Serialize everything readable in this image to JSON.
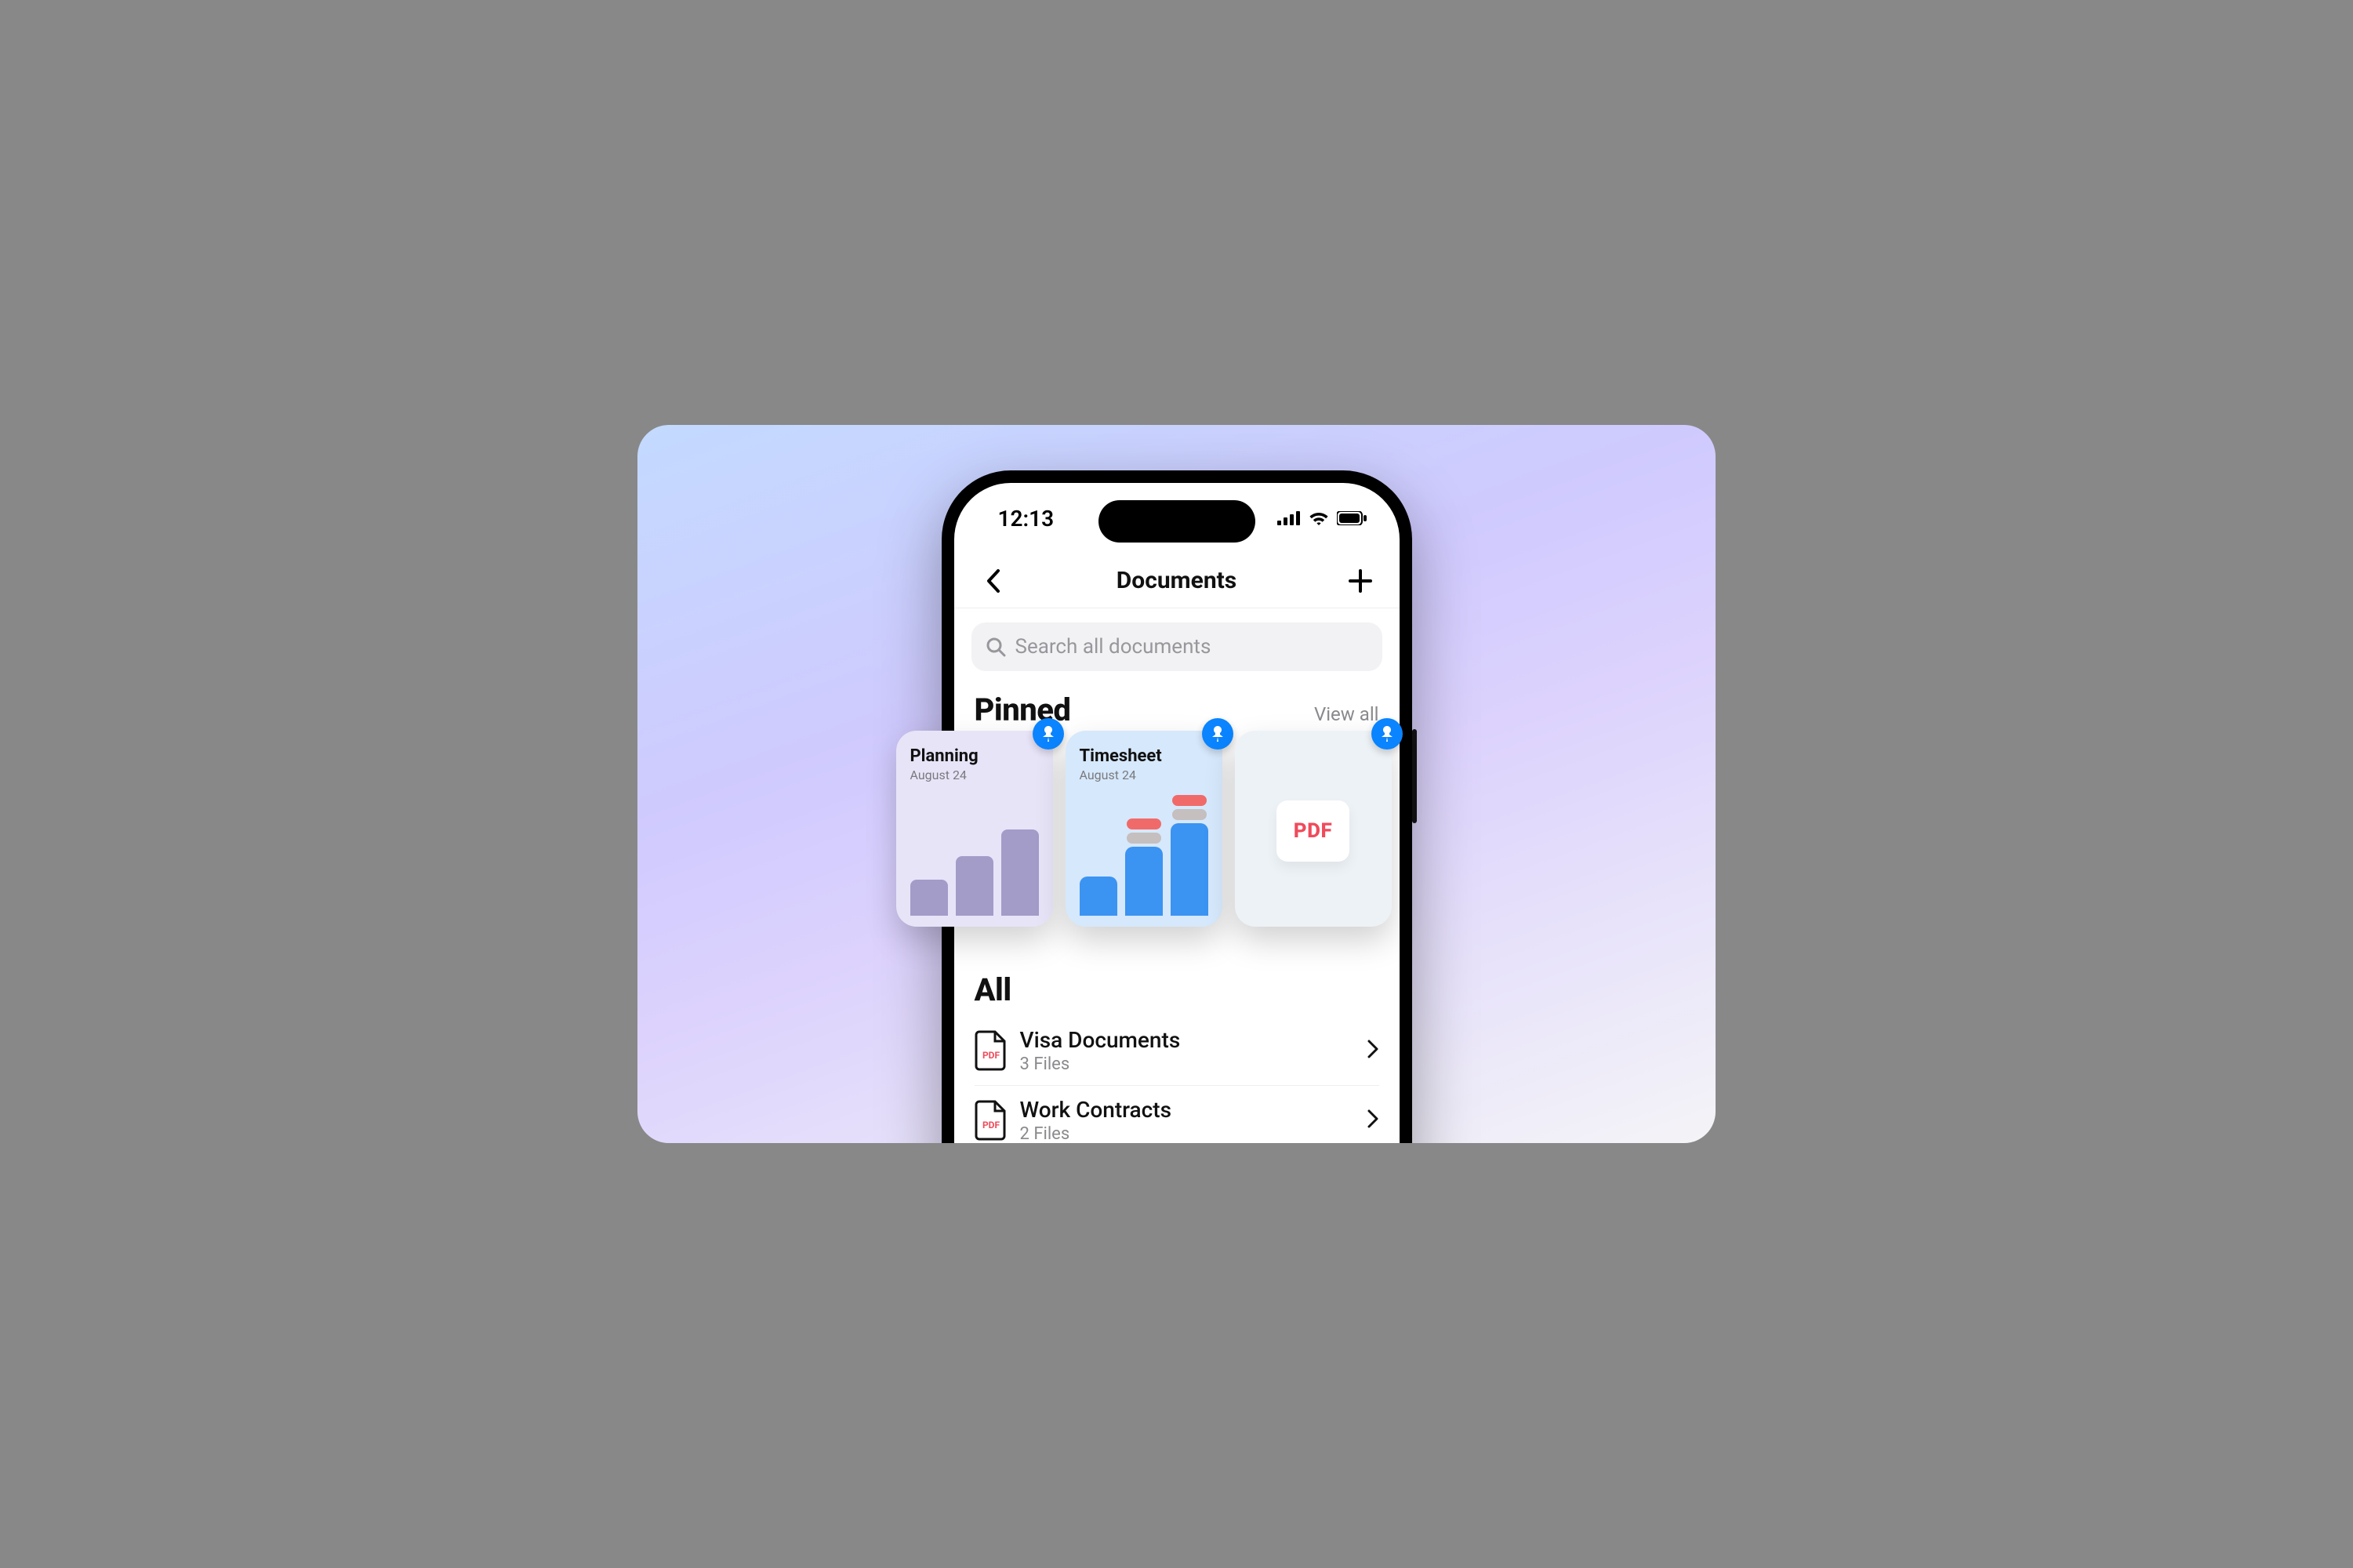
{
  "status": {
    "time": "12:13"
  },
  "nav": {
    "title": "Documents"
  },
  "search": {
    "placeholder": "Search all documents"
  },
  "pinned": {
    "heading": "Pinned",
    "view_all": "View all",
    "cards": [
      {
        "title": "Planning",
        "date": "August 24"
      },
      {
        "title": "Timesheet",
        "date": "August 24"
      },
      {
        "badge": "PDF"
      }
    ]
  },
  "all": {
    "heading": "All",
    "rows": [
      {
        "name": "Visa Documents",
        "sub": "3 Files",
        "badge": "PDF"
      },
      {
        "name": "Work Contracts",
        "sub": "2 Files",
        "badge": "PDF"
      }
    ]
  }
}
